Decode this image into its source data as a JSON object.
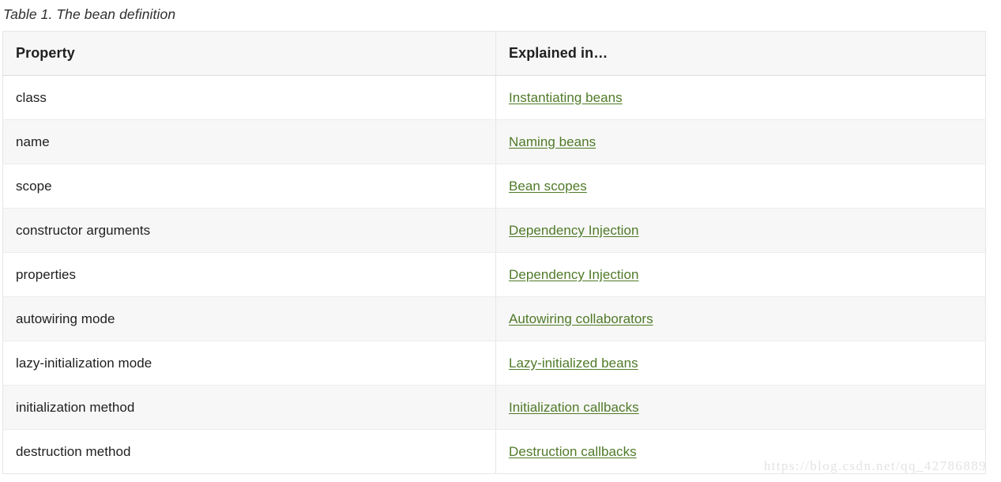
{
  "caption": "Table 1. The bean definition",
  "table": {
    "columns": [
      "Property",
      "Explained in…"
    ],
    "rows": [
      {
        "property": "class",
        "explained_in": "Instantiating beans"
      },
      {
        "property": "name",
        "explained_in": "Naming beans"
      },
      {
        "property": "scope",
        "explained_in": "Bean scopes"
      },
      {
        "property": "constructor arguments",
        "explained_in": "Dependency Injection"
      },
      {
        "property": "properties",
        "explained_in": "Dependency Injection"
      },
      {
        "property": "autowiring mode",
        "explained_in": "Autowiring collaborators"
      },
      {
        "property": "lazy-initialization mode",
        "explained_in": "Lazy-initialized beans"
      },
      {
        "property": "initialization method",
        "explained_in": "Initialization callbacks"
      },
      {
        "property": "destruction method",
        "explained_in": "Destruction callbacks"
      }
    ]
  },
  "watermark": "https://blog.csdn.net/qq_42786889",
  "colors": {
    "link": "#4f7a28",
    "header_background": "#f7f7f7",
    "stripe_background": "#f7f7f7",
    "border": "#e6e6e6",
    "text": "#1f1f1f",
    "watermark": "#e3e3e3"
  }
}
